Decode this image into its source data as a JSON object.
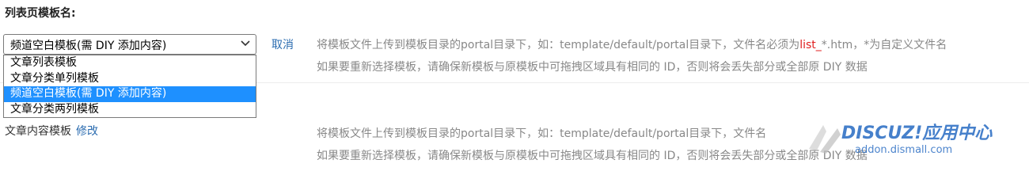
{
  "section": {
    "title": "列表页模板名:"
  },
  "template_select": {
    "selected": "频道空白模板(需 DIY 添加内容)",
    "options": [
      "文章列表模板",
      "文章分类单列模板",
      "频道空白模板(需 DIY 添加内容)",
      "文章分类两列模板"
    ],
    "selected_index": 2,
    "cancel_label": "取消"
  },
  "hint_top": {
    "line1_before": "将模板文件上传到模板目录的portal目录下，如：template/default/portal目录下，文件名必须为",
    "line1_highlight": "list_",
    "line1_after": "*.htm，*为自定义文件名",
    "line2": "如果要重新选择模板，请确保新模板与原模板中可拖拽区域具有相同的 ID，否则将会丢失部分或全部原 DIY 数据"
  },
  "content_template": {
    "label": "文章内容模板",
    "edit_label": "修改"
  },
  "hint_bottom": {
    "line1": "将模板文件上传到模板目录的portal目录下，如：template/default/portal目录下，文件名",
    "line2": "如果要重新选择模板，请确保新模板与原模板中可拖拽区域具有相同的 ID，否则将会丢失部分或全部原 DIY 数据"
  },
  "watermark": {
    "brand": "DISCUZ!应用中心",
    "url": "addon.dismall.com"
  },
  "colors": {
    "accent": "#2b6cb0",
    "highlight": "#e02020",
    "selection": "#1e90ff"
  }
}
